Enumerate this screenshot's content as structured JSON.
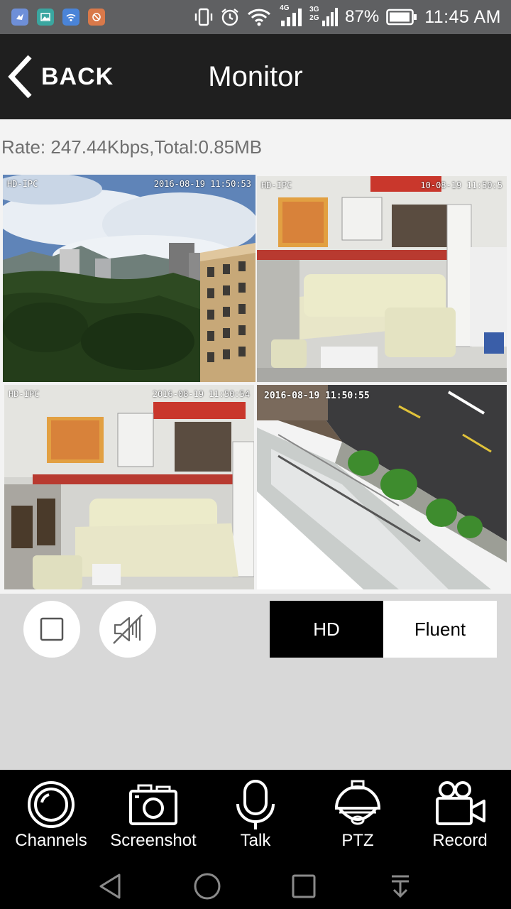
{
  "status_bar": {
    "notification_icons": [
      "vpn-bird-icon",
      "gallery-icon",
      "wifi-app-icon",
      "camera-app-icon"
    ],
    "network_type_1": "4G",
    "network_type_2a": "3G",
    "network_type_2b": "2G",
    "battery_percent": "87%",
    "time": "11:45 AM"
  },
  "header": {
    "back_label": "BACK",
    "title": "Monitor"
  },
  "rate": {
    "text": "Rate: 247.44Kbps,Total:0.85MB"
  },
  "cameras": [
    {
      "label": "HD-IPC",
      "timestamp": "2016-08-19  11:50:53",
      "selected": true
    },
    {
      "label": "HD-IPC",
      "timestamp": "10-08-19  11:50:5",
      "selected": false
    },
    {
      "label": "HD-IPC",
      "timestamp": "2016-08-19  11:50:54",
      "selected": false
    },
    {
      "label": "",
      "timestamp": "2016-08-19 11:50:55",
      "selected": false
    }
  ],
  "quality": {
    "options": [
      "HD",
      "Fluent"
    ],
    "selected": "HD"
  },
  "toolbar": {
    "items": [
      {
        "label": "Channels",
        "icon": "channels-icon"
      },
      {
        "label": "Screenshot",
        "icon": "camera-icon"
      },
      {
        "label": "Talk",
        "icon": "microphone-icon"
      },
      {
        "label": "PTZ",
        "icon": "dome-camera-icon"
      },
      {
        "label": "Record",
        "icon": "video-camera-icon"
      }
    ]
  },
  "navbar": {
    "buttons": [
      "back-triangle-icon",
      "home-circle-icon",
      "recents-square-icon",
      "notification-pull-icon"
    ]
  },
  "colors": {
    "status_bar": "#5f6062",
    "header": "#1f1f1f",
    "selected_outline": "#3fe0e8",
    "controls_bg": "#d8d8d8"
  }
}
